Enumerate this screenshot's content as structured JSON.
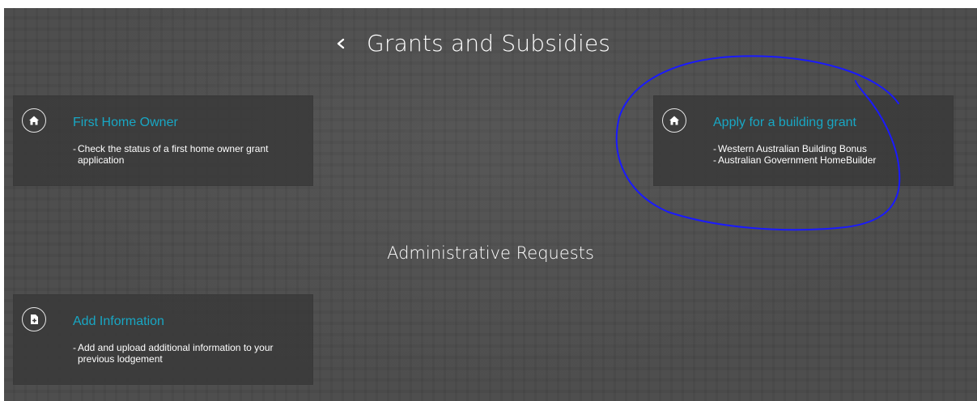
{
  "header": {
    "back_icon": "chevron-left-icon",
    "title": "Grants and Subsidies"
  },
  "cards": [
    {
      "icon": "home-icon",
      "title": "First Home Owner",
      "lines": [
        "Check the status of a first home owner grant application"
      ]
    },
    {
      "icon": "home-icon",
      "title": "Apply for a building grant",
      "lines": [
        "Western Australian Building Bonus",
        "Australian Government HomeBuilder"
      ]
    }
  ],
  "section": {
    "title": "Administrative Requests"
  },
  "admin_cards": [
    {
      "icon": "document-add-icon",
      "title": "Add Information",
      "lines": [
        "Add and upload additional information to your previous lodgement"
      ]
    }
  ],
  "colors": {
    "background": "#464646",
    "card": "#3a3a3a",
    "accent": "#18a7c4",
    "annotation": "#1a1aff"
  }
}
